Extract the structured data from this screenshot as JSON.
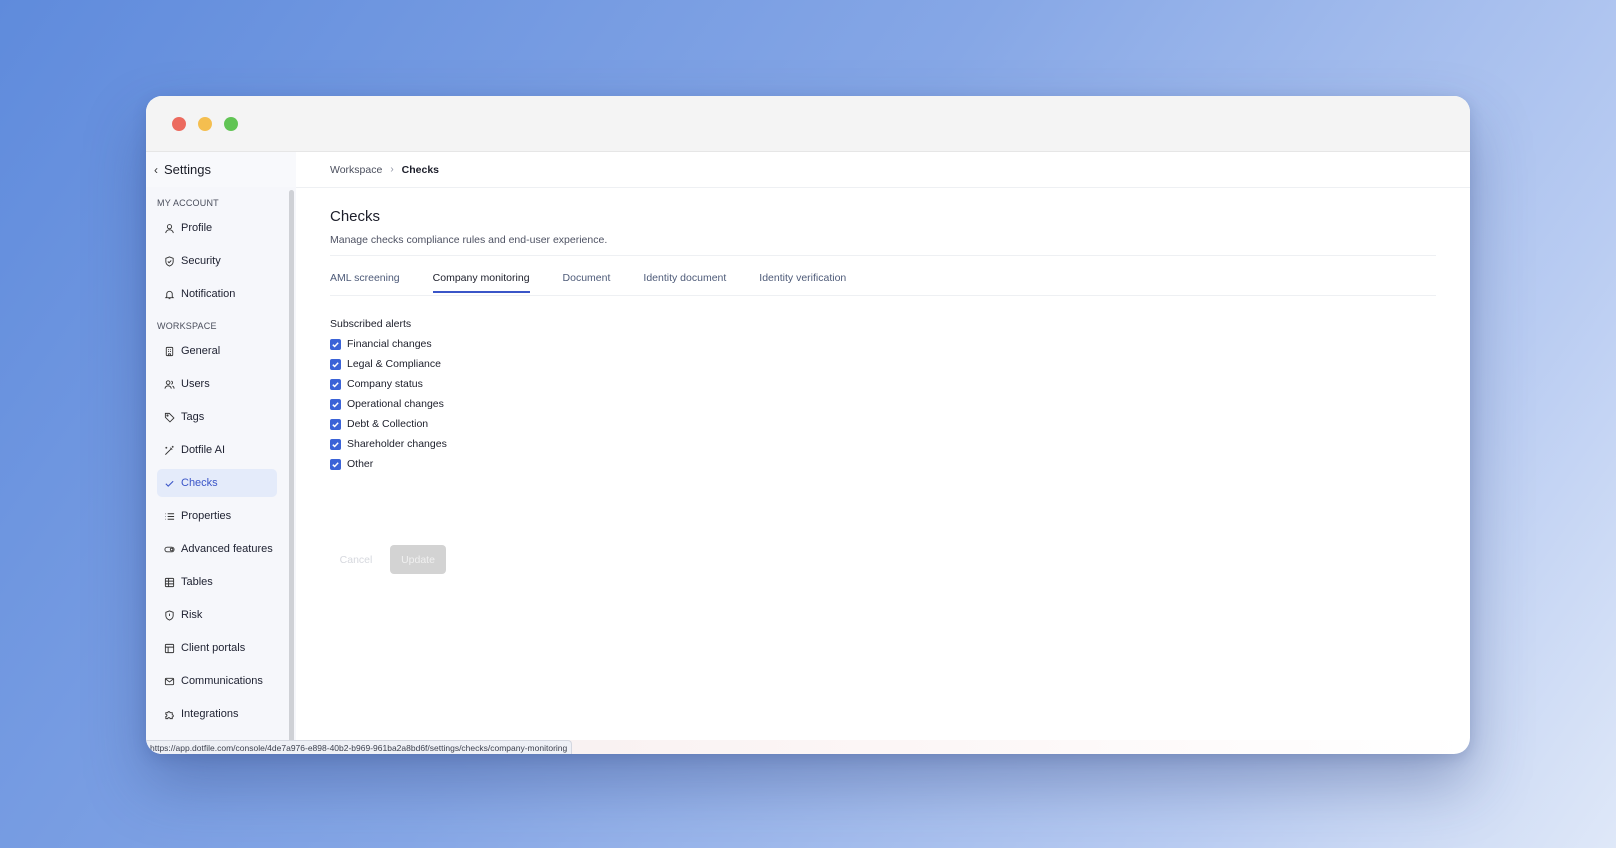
{
  "sidebar": {
    "back_label": "Settings",
    "sections": {
      "account": "MY ACCOUNT",
      "workspace": "WORKSPACE"
    },
    "items": [
      {
        "label": "Profile",
        "icon": "user-icon"
      },
      {
        "label": "Security",
        "icon": "shield-check-icon"
      },
      {
        "label": "Notification",
        "icon": "bell-icon"
      },
      {
        "label": "General",
        "icon": "building-icon"
      },
      {
        "label": "Users",
        "icon": "users-icon"
      },
      {
        "label": "Tags",
        "icon": "tag-icon"
      },
      {
        "label": "Dotfile AI",
        "icon": "magic-wand-icon"
      },
      {
        "label": "Checks",
        "icon": "check-icon"
      },
      {
        "label": "Properties",
        "icon": "list-icon"
      },
      {
        "label": "Advanced features",
        "icon": "toggle-icon"
      },
      {
        "label": "Tables",
        "icon": "table-icon"
      },
      {
        "label": "Risk",
        "icon": "shield-icon"
      },
      {
        "label": "Client portals",
        "icon": "layout-icon"
      },
      {
        "label": "Communications",
        "icon": "mail-icon"
      },
      {
        "label": "Integrations",
        "icon": "puzzle-icon"
      }
    ],
    "active_item": "Checks"
  },
  "breadcrumb": {
    "parent": "Workspace",
    "current": "Checks"
  },
  "page": {
    "title": "Checks",
    "description": "Manage checks compliance rules and end-user experience."
  },
  "tabs": [
    {
      "label": "AML screening",
      "active": false
    },
    {
      "label": "Company monitoring",
      "active": true
    },
    {
      "label": "Document",
      "active": false
    },
    {
      "label": "Identity document",
      "active": false
    },
    {
      "label": "Identity verification",
      "active": false
    }
  ],
  "alerts": {
    "title": "Subscribed alerts",
    "items": [
      {
        "label": "Financial changes",
        "checked": true
      },
      {
        "label": "Legal & Compliance",
        "checked": true
      },
      {
        "label": "Company status",
        "checked": true
      },
      {
        "label": "Operational changes",
        "checked": true
      },
      {
        "label": "Debt & Collection",
        "checked": true
      },
      {
        "label": "Shareholder changes",
        "checked": true
      },
      {
        "label": "Other",
        "checked": true
      }
    ]
  },
  "actions": {
    "cancel": "Cancel",
    "update": "Update"
  },
  "status_bar": {
    "url": "https://app.dotfile.com/console/4de7a976-e898-40b2-b969-961ba2a8bd6f/settings/checks/company-monitoring"
  },
  "colors": {
    "accent": "#3a55c8",
    "checkbox": "#3b63d7",
    "active_nav_bg": "#e4ebfa"
  }
}
